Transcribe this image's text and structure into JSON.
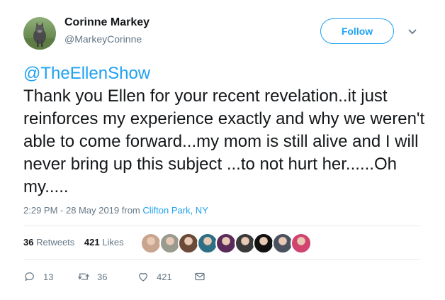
{
  "user": {
    "name": "Corinne Markey",
    "handle": "@MarkeyCorinne",
    "avatar_icon": "dog-photo-avatar"
  },
  "follow_label": "Follow",
  "tweet": {
    "mention": "@TheEllenShow",
    "body": "Thank you Ellen for your recent revelation..it just reinforces my experience exactly and why we weren't able to come forward...my mom is still alive and I will never bring up this subject ...to not hurt her......Oh my....."
  },
  "meta": {
    "timestamp": "2:29 PM - 28 May 2019",
    "from": "from",
    "place": "Clifton Park, NY"
  },
  "stats": {
    "retweets_count": "36",
    "retweets_label": "Retweets",
    "likes_count": "421",
    "likes_label": "Likes"
  },
  "likers": [
    {
      "color": "#c9a48f"
    },
    {
      "color": "#9a9a8f"
    },
    {
      "color": "#6b4a3a"
    },
    {
      "color": "#2f6f86"
    },
    {
      "color": "#5a2a5a"
    },
    {
      "color": "#3a3a3a"
    },
    {
      "color": "#111111"
    },
    {
      "color": "#4a5260"
    },
    {
      "color": "#d0446f"
    }
  ],
  "actions": {
    "reply_count": "13",
    "retweet_count": "36",
    "like_count": "421"
  },
  "colors": {
    "accent": "#1da1f2",
    "muted": "#657786",
    "divider": "#e6ecf0"
  }
}
